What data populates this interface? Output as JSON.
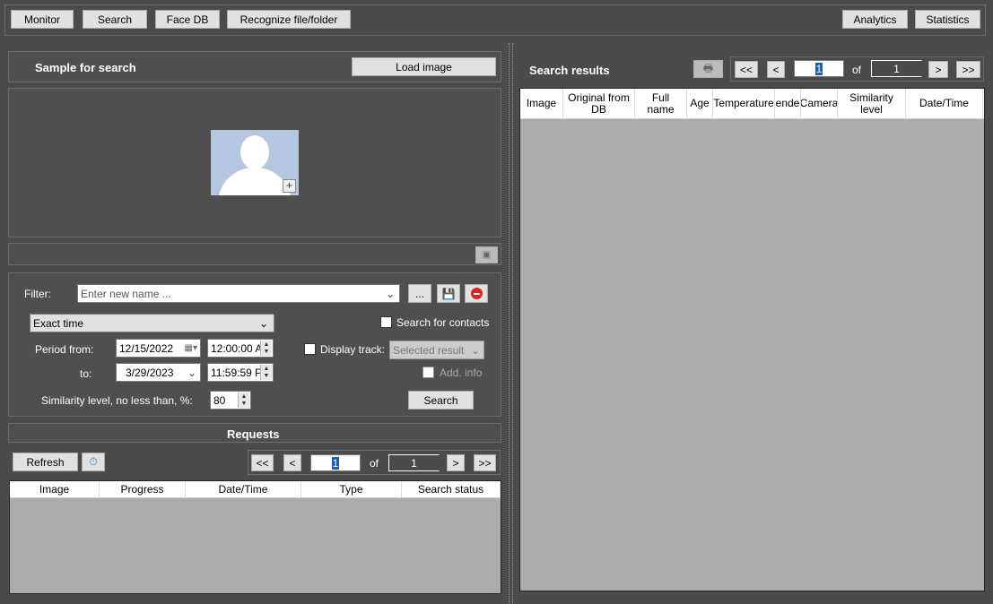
{
  "toolbar": {
    "monitor": "Monitor",
    "search": "Search",
    "face_db": "Face DB",
    "recognize": "Recognize file/folder",
    "analytics": "Analytics",
    "statistics": "Statistics"
  },
  "sample": {
    "title": "Sample for search",
    "load_image": "Load image"
  },
  "filter": {
    "label": "Filter:",
    "placeholder": "Enter new name ...",
    "more": "...",
    "mode": "Exact time",
    "search_contacts": "Search for contacts",
    "period_from": "Period from:",
    "to": "to:",
    "date_from": "12/15/2022",
    "time_from": "12:00:00 A",
    "date_to": "3/29/2023",
    "time_to": "11:59:59 P",
    "display_track": "Display track:",
    "track_value": "Selected result",
    "add_info": "Add. info",
    "similarity_label": "Similarity level, no less than, %:",
    "similarity": "80",
    "search": "Search"
  },
  "requests": {
    "title": "Requests",
    "refresh": "Refresh",
    "first": "<<",
    "prev": "<",
    "page": "1",
    "of": "of",
    "total": "1",
    "next": ">",
    "last": ">>",
    "columns": [
      "Image",
      "Progress",
      "Date/Time",
      "Type",
      "Search status"
    ]
  },
  "results": {
    "title": "Search results",
    "first": "<<",
    "prev": "<",
    "page": "1",
    "of": "of",
    "total": "1",
    "next": ">",
    "last": ">>",
    "columns": [
      "Image",
      "Original from DB",
      "Full name",
      "Age",
      "Temperature",
      "ende",
      "Camera",
      "Similarity level",
      "Date/Time"
    ]
  }
}
